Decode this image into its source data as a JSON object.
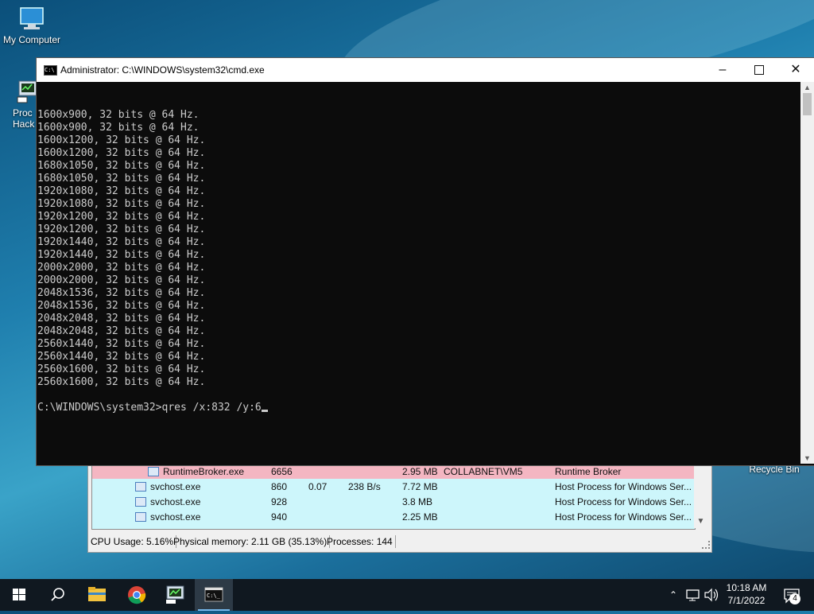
{
  "desktop": {
    "icons": [
      {
        "label": "My Computer"
      },
      {
        "label": "Proc\nHack"
      },
      {
        "label": "Recycle Bin"
      }
    ]
  },
  "cmd": {
    "title": "Administrator: C:\\WINDOWS\\system32\\cmd.exe",
    "lines": [
      "1600x900, 32 bits @ 64 Hz.",
      "1600x900, 32 bits @ 64 Hz.",
      "1600x1200, 32 bits @ 64 Hz.",
      "1600x1200, 32 bits @ 64 Hz.",
      "1680x1050, 32 bits @ 64 Hz.",
      "1680x1050, 32 bits @ 64 Hz.",
      "1920x1080, 32 bits @ 64 Hz.",
      "1920x1080, 32 bits @ 64 Hz.",
      "1920x1200, 32 bits @ 64 Hz.",
      "1920x1200, 32 bits @ 64 Hz.",
      "1920x1440, 32 bits @ 64 Hz.",
      "1920x1440, 32 bits @ 64 Hz.",
      "2000x2000, 32 bits @ 64 Hz.",
      "2000x2000, 32 bits @ 64 Hz.",
      "2048x1536, 32 bits @ 64 Hz.",
      "2048x1536, 32 bits @ 64 Hz.",
      "2048x2048, 32 bits @ 64 Hz.",
      "2048x2048, 32 bits @ 64 Hz.",
      "2560x1440, 32 bits @ 64 Hz.",
      "2560x1440, 32 bits @ 64 Hz.",
      "2560x1600, 32 bits @ 64 Hz.",
      "2560x1600, 32 bits @ 64 Hz.",
      ""
    ],
    "prompt": "C:\\WINDOWS\\system32>qres /x:832 /y:6"
  },
  "process_explorer": {
    "rows": [
      {
        "name": "RuntimeBroker.exe",
        "pid": "6656",
        "cpu": "",
        "io": "",
        "mem": "2.95 MB",
        "user": "COLLABNET\\VM5",
        "desc": "Runtime Broker",
        "color": "#f4b6c2"
      },
      {
        "name": "svchost.exe",
        "pid": "860",
        "cpu": "0.07",
        "io": "238 B/s",
        "mem": "7.72 MB",
        "user": "",
        "desc": "Host Process for Windows Ser...",
        "color": "#cdf6fb"
      },
      {
        "name": "svchost.exe",
        "pid": "928",
        "cpu": "",
        "io": "",
        "mem": "3.8 MB",
        "user": "",
        "desc": "Host Process for Windows Ser...",
        "color": "#cdf6fb"
      },
      {
        "name": "svchost.exe",
        "pid": "940",
        "cpu": "",
        "io": "",
        "mem": "2.25 MB",
        "user": "",
        "desc": "Host Process for Windows Ser...",
        "color": "#cdf6fb"
      }
    ],
    "status": {
      "cpu": "CPU Usage: 5.16%",
      "memory": "Physical memory: 2.11 GB (35.13%)",
      "processes": "Processes: 144"
    }
  },
  "taskbar": {
    "apps": [
      "start-icon",
      "search-icon",
      "file-explorer-icon",
      "chrome-icon",
      "process-hacker-icon",
      "cmd-icon"
    ],
    "clock_time": "10:18 AM",
    "clock_date": "7/1/2022",
    "notification_count": "4"
  }
}
